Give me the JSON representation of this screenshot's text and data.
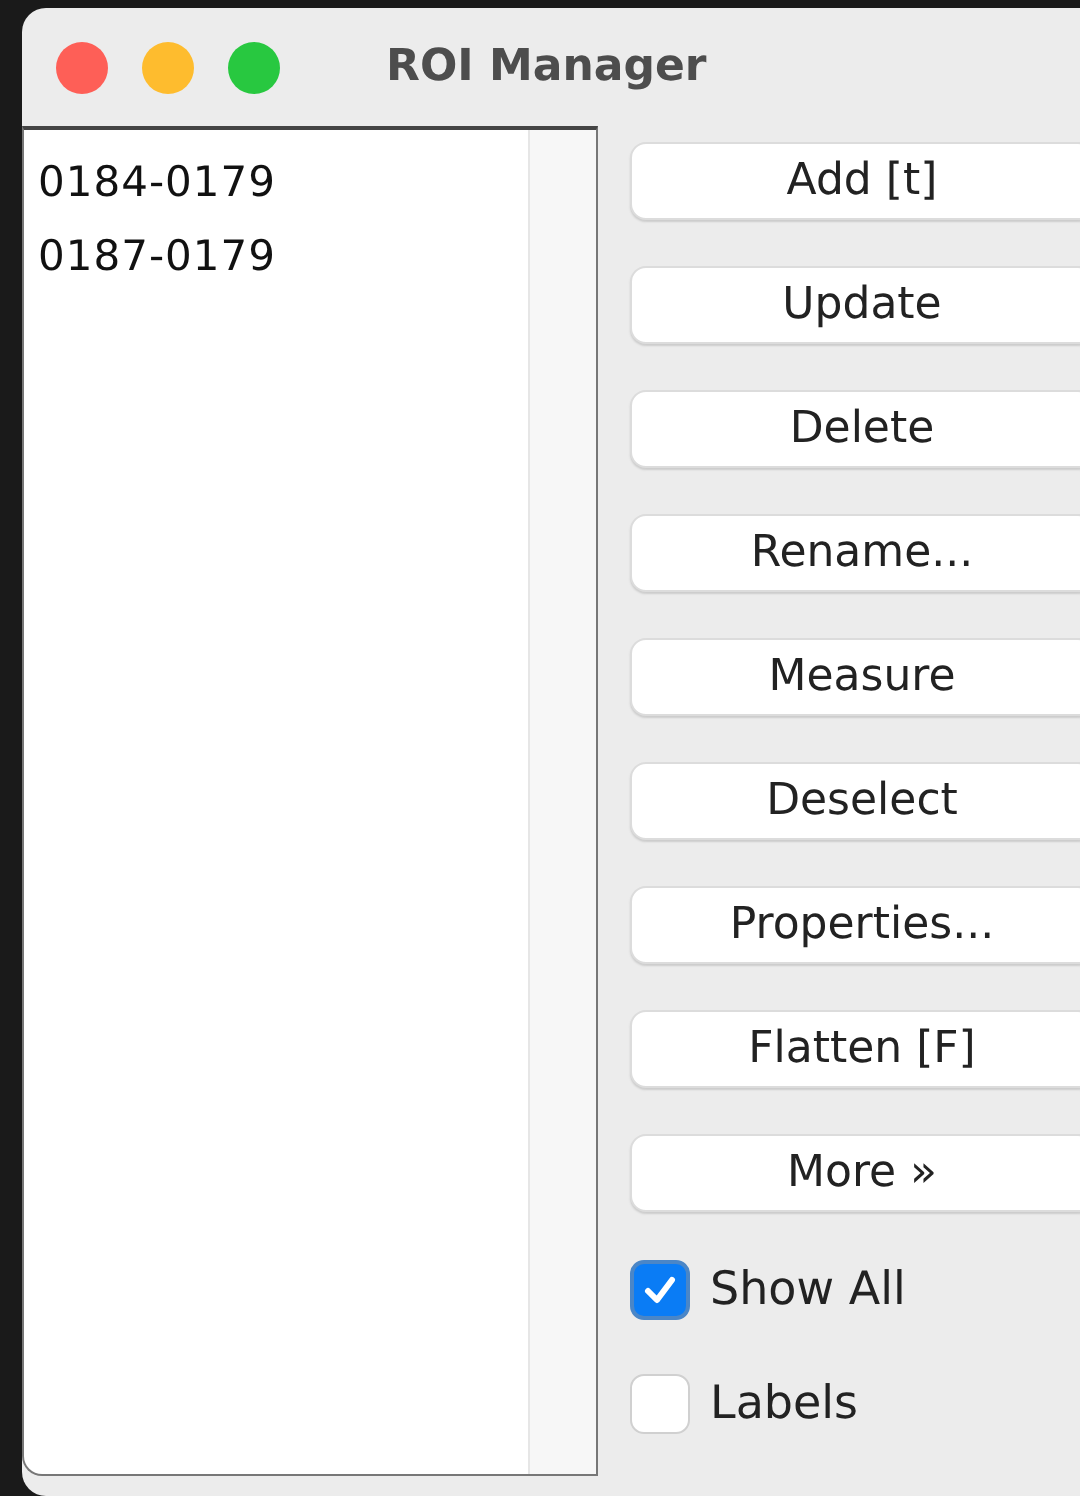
{
  "window": {
    "title": "ROI Manager"
  },
  "list": {
    "items": [
      {
        "label": "0184-0179",
        "selected": false
      },
      {
        "label": "0187-0179",
        "selected": false
      }
    ]
  },
  "buttons": [
    "Add [t]",
    "Update",
    "Delete",
    "Rename...",
    "Measure",
    "Deselect",
    "Properties...",
    "Flatten [F]",
    "More »"
  ],
  "checkboxes": [
    {
      "label": "Show All",
      "checked": true
    },
    {
      "label": "Labels",
      "checked": false
    }
  ]
}
